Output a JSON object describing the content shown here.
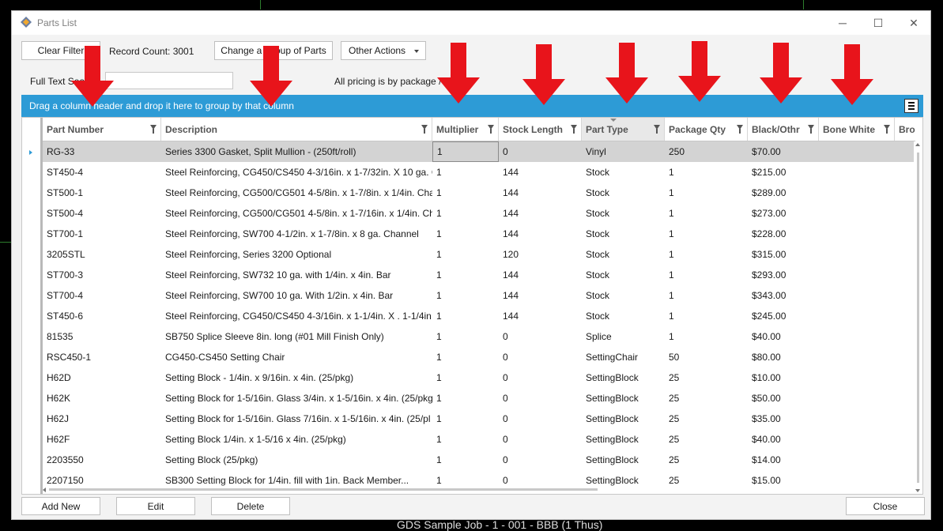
{
  "window": {
    "title": "Parts List",
    "min_glyph": "─",
    "max_glyph": "☐",
    "close_glyph": "✕"
  },
  "toolbar": {
    "clear_filter": "Clear Filter",
    "record_count": "Record Count: 3001",
    "change_group": "Change a Group of Parts",
    "other_actions": "Other Actions"
  },
  "search": {
    "label": "Full Text Search",
    "value": "",
    "pricing_note": "All pricing is by package / l"
  },
  "group_panel": {
    "text": "Drag a column header and drop it here to group by that column"
  },
  "columns": [
    "Part Number",
    "Description",
    "Multiplier",
    "Stock Length",
    "Part Type",
    "Package Qty",
    "Black/Othr",
    "Bone White",
    "Bro"
  ],
  "rows": [
    [
      "RG-33",
      "Series 3300 Gasket, Split Mullion -  (250ft/roll)",
      "1",
      "0",
      "Vinyl",
      "250",
      "$70.00",
      ""
    ],
    [
      "ST450-4",
      "Steel Reinforcing, CG450/CS450 4-3/16in. x 1-7/32in. X 10 ga. C",
      "1",
      "144",
      "Stock",
      "1",
      "$215.00",
      ""
    ],
    [
      "ST500-1",
      "Steel Reinforcing, CG500/CG501 4-5/8in. x 1-7/8in. x 1/4in. Cha",
      "1",
      "144",
      "Stock",
      "1",
      "$289.00",
      ""
    ],
    [
      "ST500-4",
      "Steel Reinforcing, CG500/CG501 4-5/8in. x 1-7/16in. x 1/4in. Ch",
      "1",
      "144",
      "Stock",
      "1",
      "$273.00",
      ""
    ],
    [
      "ST700-1",
      "Steel Reinforcing, SW700 4-1/2in. x 1-7/8in. x 8 ga. Channel",
      "1",
      "144",
      "Stock",
      "1",
      "$228.00",
      ""
    ],
    [
      "3205STL",
      "Steel Reinforcing, Series 3200 Optional",
      "1",
      "120",
      "Stock",
      "1",
      "$315.00",
      ""
    ],
    [
      "ST700-3",
      "Steel Reinforcing, SW732 10 ga. with 1/4in. x 4in. Bar",
      "1",
      "144",
      "Stock",
      "1",
      "$293.00",
      ""
    ],
    [
      "ST700-4",
      "Steel Reinforcing, SW700 10 ga. With 1/2in. x 4in. Bar",
      "1",
      "144",
      "Stock",
      "1",
      "$343.00",
      ""
    ],
    [
      "ST450-6",
      "Steel Reinforcing, CG450/CS450 4-3/16in. x 1-1/4in. X . 1-1/4in",
      "1",
      "144",
      "Stock",
      "1",
      "$245.00",
      ""
    ],
    [
      "81535",
      "SB750 Splice Sleeve 8in. long (#01 Mill Finish Only)",
      "1",
      "0",
      "Splice",
      "1",
      "$40.00",
      ""
    ],
    [
      "RSC450-1",
      "CG450-CS450 Setting Chair",
      "1",
      "0",
      "SettingChair",
      "50",
      "$80.00",
      ""
    ],
    [
      "H62D",
      "Setting Block - 1/4in. x 9/16in. x 4in. (25/pkg)",
      "1",
      "0",
      "SettingBlock",
      "25",
      "$10.00",
      ""
    ],
    [
      "H62K",
      "Setting Block for 1-5/16in. Glass 3/4in. x 1-5/16in. x 4in. (25/pkg",
      "1",
      "0",
      "SettingBlock",
      "25",
      "$50.00",
      ""
    ],
    [
      "H62J",
      "Setting Block for 1-5/16in. Glass 7/16in. x 1-5/16in. x 4in. (25/pl",
      "1",
      "0",
      "SettingBlock",
      "25",
      "$35.00",
      ""
    ],
    [
      "H62F",
      "Setting Block 1/4in. x 1-5/16 x 4in. (25/pkg)",
      "1",
      "0",
      "SettingBlock",
      "25",
      "$40.00",
      ""
    ],
    [
      "2203550",
      "Setting Block (25/pkg)",
      "1",
      "0",
      "SettingBlock",
      "25",
      "$14.00",
      ""
    ],
    [
      "2207150",
      "SB300 Setting Block for 1/4in. fill with 1in. Back Member...",
      "1",
      "0",
      "SettingBlock",
      "25",
      "$15.00",
      ""
    ]
  ],
  "footer": {
    "add_new": "Add New",
    "edit": "Edit",
    "delete": "Delete",
    "close": "Close"
  },
  "background_text": "GDS Sample Job - 1 - 001 - BBB (1 Thus)",
  "colors": {
    "accent": "#2d9bd6",
    "arrow": "#e8141b",
    "selected_row": "#d3d3d3"
  }
}
